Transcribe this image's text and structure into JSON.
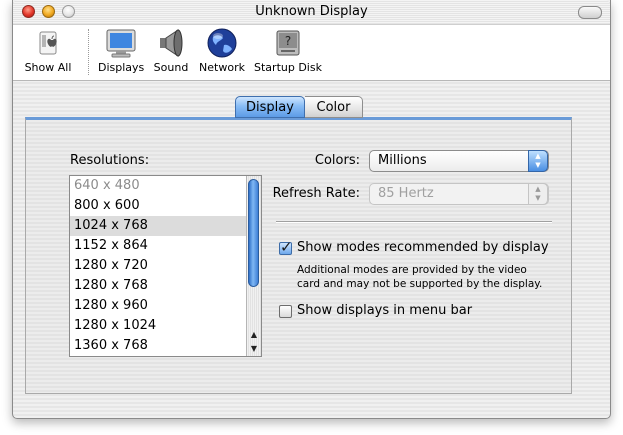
{
  "window": {
    "title": "Unknown Display"
  },
  "toolbar": {
    "items": [
      {
        "label": "Show All",
        "icon": "show-all-icon"
      },
      {
        "label": "Displays",
        "icon": "displays-icon"
      },
      {
        "label": "Sound",
        "icon": "sound-icon"
      },
      {
        "label": "Network",
        "icon": "network-globe-icon"
      },
      {
        "label": "Startup Disk",
        "icon": "startup-disk-icon"
      }
    ]
  },
  "tabs": [
    {
      "label": "Display",
      "active": true
    },
    {
      "label": "Color",
      "active": false
    }
  ],
  "resolutions": {
    "label": "Resolutions:",
    "items": [
      "640 x 480",
      "800 x 600",
      "1024 x 768",
      "1152 x 864",
      "1280 x 720",
      "1280 x 768",
      "1280 x 960",
      "1280 x 1024",
      "1360 x 768"
    ],
    "selected": "1024 x 768",
    "disabled": [
      "640 x 480"
    ]
  },
  "colors": {
    "label": "Colors:",
    "value": "Millions"
  },
  "refresh_rate": {
    "label": "Refresh Rate:",
    "value": "85 Hertz",
    "enabled": false
  },
  "show_recommended": {
    "label": "Show modes recommended by display",
    "checked": true,
    "help_line1": "Additional modes are provided by the video",
    "help_line2": "card and may not be supported by the display."
  },
  "show_menu_bar": {
    "label": "Show displays in menu bar",
    "checked": false
  },
  "accent_color": "#5d9be6"
}
